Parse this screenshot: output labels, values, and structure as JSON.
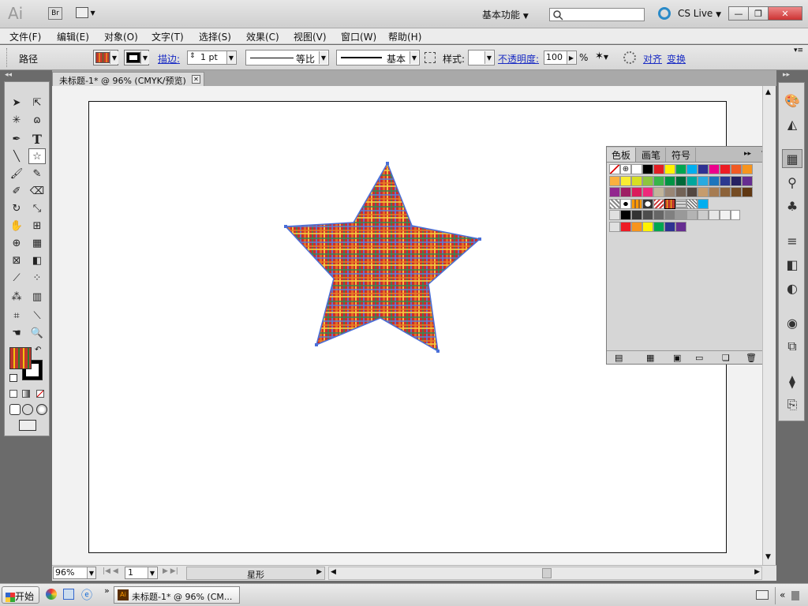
{
  "app": {
    "logo": "Ai",
    "bridge": "Br",
    "workspace": "基本功能",
    "cs_live": "CS Live"
  },
  "menu": [
    "文件(F)",
    "编辑(E)",
    "对象(O)",
    "文字(T)",
    "选择(S)",
    "效果(C)",
    "视图(V)",
    "窗口(W)",
    "帮助(H)"
  ],
  "control": {
    "object_label": "路径",
    "stroke_label": "描边:",
    "stroke_weight": "1 pt",
    "profile_label": "等比",
    "brush_label": "基本",
    "style_label": "样式:",
    "opacity_label": "不透明度:",
    "opacity_value": "100",
    "opacity_unit": "%",
    "align_label": "对齐",
    "transform_label": "变换"
  },
  "document": {
    "tab_title": "未标题-1* @ 96% (CMYK/预览)"
  },
  "swatches_panel": {
    "tabs": [
      "色板",
      "画笔",
      "符号"
    ]
  },
  "status": {
    "zoom": "96%",
    "artboard": "1",
    "tool_name": "星形"
  },
  "taskbar": {
    "start": "开始",
    "task": "未标题-1* @ 96% (CM..."
  },
  "colors": {
    "accent": "#1a2cc4",
    "selection": "#4a6fd8"
  }
}
